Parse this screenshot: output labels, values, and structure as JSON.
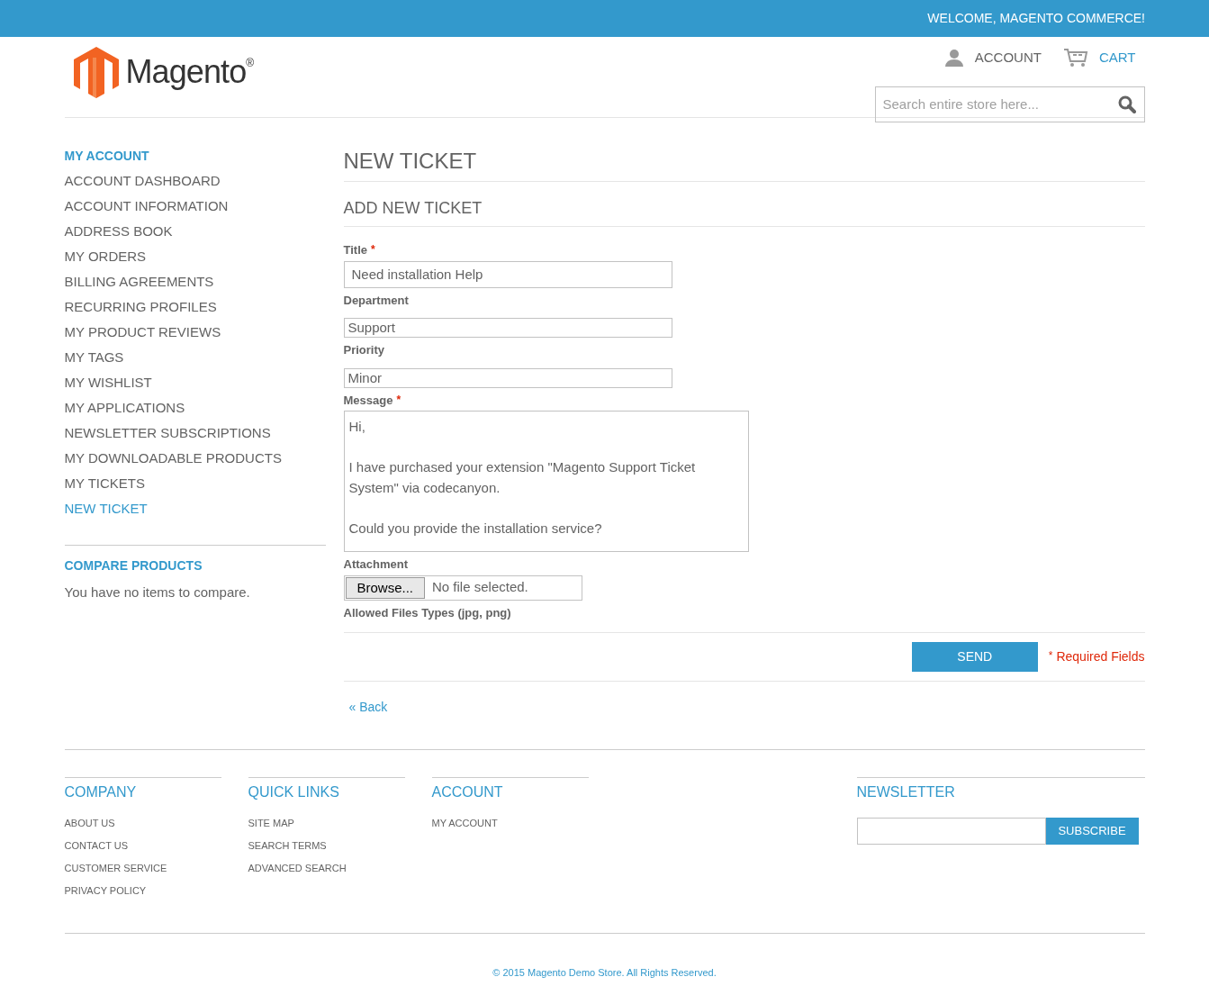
{
  "top_bar": {
    "welcome": "WELCOME, MAGENTO COMMERCE!"
  },
  "header": {
    "logo": "Magento",
    "logo_mark": "®",
    "links": [
      {
        "label": "ACCOUNT",
        "kind": "account"
      },
      {
        "label": "CART",
        "kind": "cart"
      }
    ],
    "search": {
      "placeholder": "Search entire store here..."
    }
  },
  "sidebar": {
    "title": "MY ACCOUNT",
    "items": [
      {
        "label": "ACCOUNT DASHBOARD",
        "selected": false
      },
      {
        "label": "ACCOUNT INFORMATION",
        "selected": false
      },
      {
        "label": "ADDRESS BOOK",
        "selected": false
      },
      {
        "label": "MY ORDERS",
        "selected": false
      },
      {
        "label": "BILLING AGREEMENTS",
        "selected": false
      },
      {
        "label": "RECURRING PROFILES",
        "selected": false
      },
      {
        "label": "MY PRODUCT REVIEWS",
        "selected": false
      },
      {
        "label": "MY TAGS",
        "selected": false
      },
      {
        "label": "MY WISHLIST",
        "selected": false
      },
      {
        "label": "MY APPLICATIONS",
        "selected": false
      },
      {
        "label": "NEWSLETTER SUBSCRIPTIONS",
        "selected": false
      },
      {
        "label": "MY DOWNLOADABLE PRODUCTS",
        "selected": false
      },
      {
        "label": "MY TICKETS",
        "selected": false
      },
      {
        "label": "NEW TICKET",
        "selected": true
      }
    ],
    "compare": {
      "title": "COMPARE PRODUCTS",
      "text": "You have no items to compare."
    }
  },
  "main": {
    "title": "NEW TICKET",
    "subtitle": "ADD NEW TICKET",
    "fields": [
      {
        "label": "Title",
        "required": true,
        "kind": "text",
        "value": "Need installation Help"
      },
      {
        "label": "Department",
        "required": false,
        "kind": "select",
        "value": "Support"
      },
      {
        "label": "Priority",
        "required": false,
        "kind": "select",
        "value": "Minor"
      },
      {
        "label": "Message",
        "required": true,
        "kind": "textarea",
        "value": "Hi,\n\nI have purchased your extension \"Magento Support Ticket System\" via codecanyon.\n\nCould you provide the installation service?"
      }
    ],
    "attachment": {
      "label": "Attachment",
      "button": "Browse...",
      "status": "No file selected.",
      "hint": "Allowed Files Types (jpg, png)"
    },
    "send": "SEND",
    "required_mark": "*",
    "required_note": "Required Fields",
    "back": "« Back"
  },
  "footer": {
    "columns": [
      {
        "title": "COMPANY",
        "links": [
          "ABOUT US",
          "CONTACT US",
          "CUSTOMER SERVICE",
          "PRIVACY POLICY"
        ]
      },
      {
        "title": "QUICK LINKS",
        "links": [
          "SITE MAP",
          "SEARCH TERMS",
          "ADVANCED SEARCH"
        ]
      },
      {
        "title": "ACCOUNT",
        "links": [
          "MY ACCOUNT"
        ]
      }
    ],
    "newsletter": {
      "title": "NEWSLETTER",
      "button": "SUBSCRIBE"
    },
    "copyright": "© 2015 Magento Demo Store. All Rights Reserved."
  }
}
